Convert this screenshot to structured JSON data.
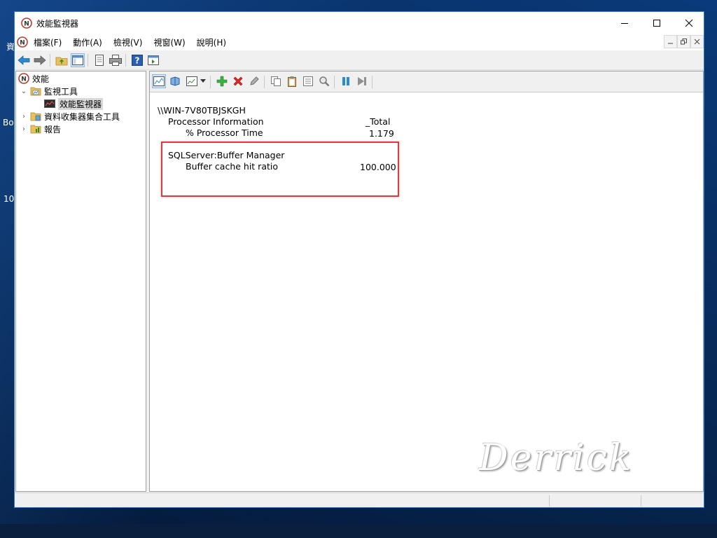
{
  "desktop": {
    "texts": [
      "資",
      "Bo",
      "10"
    ]
  },
  "window": {
    "title": "效能監視器"
  },
  "menu": {
    "items": [
      "檔案(F)",
      "動作(A)",
      "檢視(V)",
      "視窗(W)",
      "說明(H)"
    ]
  },
  "tree": {
    "root": "效能",
    "monitoring_tools": "監視工具",
    "performance_monitor": "效能監視器",
    "data_collector_sets": "資料收集器集合工具",
    "reports": "報告"
  },
  "report": {
    "computer": "\\\\WIN-7V80TBJSKGH",
    "objects": [
      {
        "name": "Processor Information",
        "instance": "_Total",
        "counters": [
          {
            "name": "% Processor Time",
            "value": "1.179"
          }
        ]
      },
      {
        "name": "SQLServer:Buffer Manager",
        "instance": "",
        "counters": [
          {
            "name": "Buffer cache hit ratio",
            "value": "100.000"
          }
        ]
      }
    ]
  },
  "watermark": "Derrick",
  "colors": {
    "highlight": "#e0393e",
    "window_border": "#2b79d8"
  }
}
